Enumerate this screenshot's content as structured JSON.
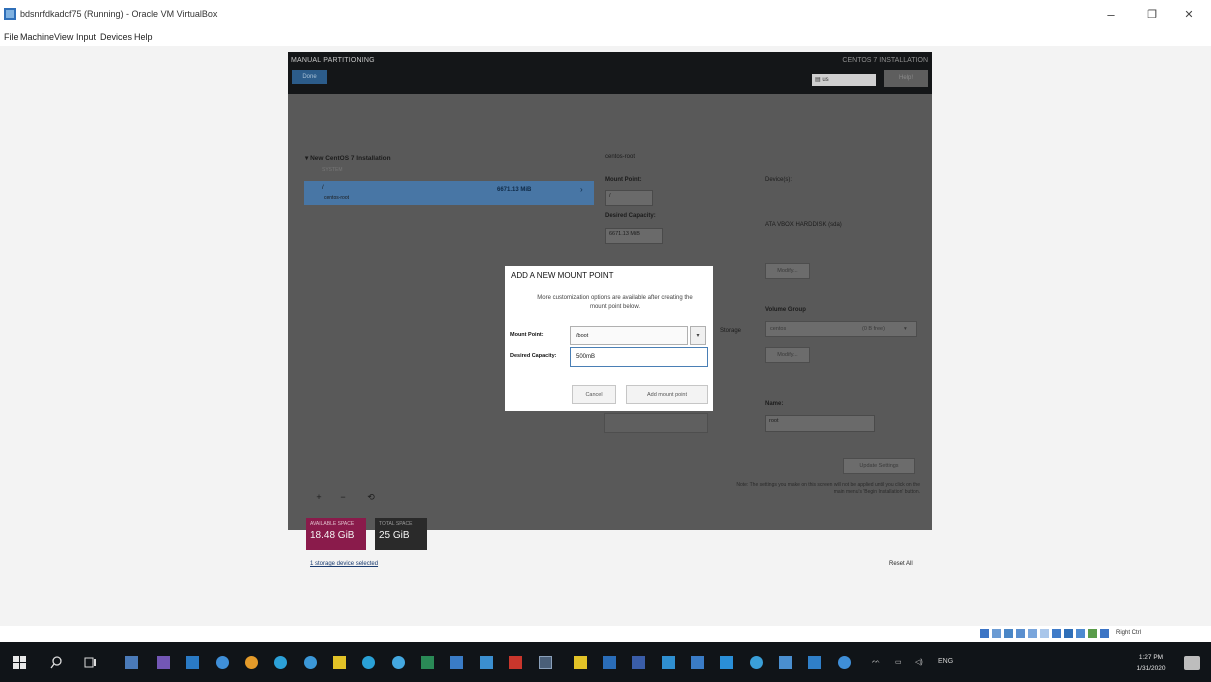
{
  "window": {
    "title": "bdsnrfdkadcf75 (Running) - Oracle VM VirtualBox",
    "controls": {
      "minimize": "–",
      "restore": "❐",
      "close": "✕"
    }
  },
  "menubar": [
    "File",
    "Machine",
    "View",
    "Input",
    "Devices",
    "Help"
  ],
  "installer": {
    "header_title": "MANUAL PARTITIONING",
    "done_label": "Done",
    "install_title": "CENTOS 7 INSTALLATION",
    "keyboard": "us",
    "help_label": "Help!",
    "tree_header": "▾ New CentOS 7 Installation",
    "system_label": "SYSTEM",
    "root_mount": "/",
    "root_sub": "centos-root",
    "root_size": "6671.13 MiB",
    "right_header": "centos-root",
    "mount_point_label": "Mount Point:",
    "mount_point_value": "/",
    "desired_capacity_label": "Desired Capacity:",
    "desired_capacity_value": "6671.13 MiB",
    "device_label": "Device(s):",
    "device_value": "ATA VBOX HARDDISK (sda)",
    "modify_label": "Modify...",
    "volume_group_label": "Volume Group",
    "volume_group_value": "centos",
    "volume_group_free": "(0 B free)",
    "modify2_label": "Modify...",
    "name_label": "Name:",
    "name_value": "root",
    "update_settings": "Update Settings",
    "note": "Note:  The settings you make on this screen will not be applied until you click on the main menu's 'Begin Installation' button.",
    "plus": "+",
    "minus": "−",
    "refresh": "⟲",
    "available_label": "AVAILABLE SPACE",
    "available_value": "18.48 GiB",
    "total_label": "TOTAL SPACE",
    "total_value": "25 GiB",
    "storage_link": "1 storage device selected",
    "reset_all": "Reset All",
    "storage_label": "Storage"
  },
  "dialog": {
    "title": "ADD A NEW MOUNT POINT",
    "info": "More customization options are available after creating the mount point below.",
    "mount_point_label": "Mount Point:",
    "mount_point_value": "/boot",
    "capacity_label": "Desired Capacity:",
    "capacity_value": "500mB",
    "cancel_label": "Cancel",
    "add_label": "Add mount point"
  },
  "tray": {
    "right_ctrl": "Right Ctrl"
  },
  "taskbar": {
    "language": "ENG",
    "time": "1:27 PM",
    "date": "1/31/2020"
  },
  "colors": {
    "vm_background": "#595959",
    "header": "#141618",
    "selection": "#4876a5",
    "available": "#8a1b4b",
    "taskbar": "#101418"
  }
}
